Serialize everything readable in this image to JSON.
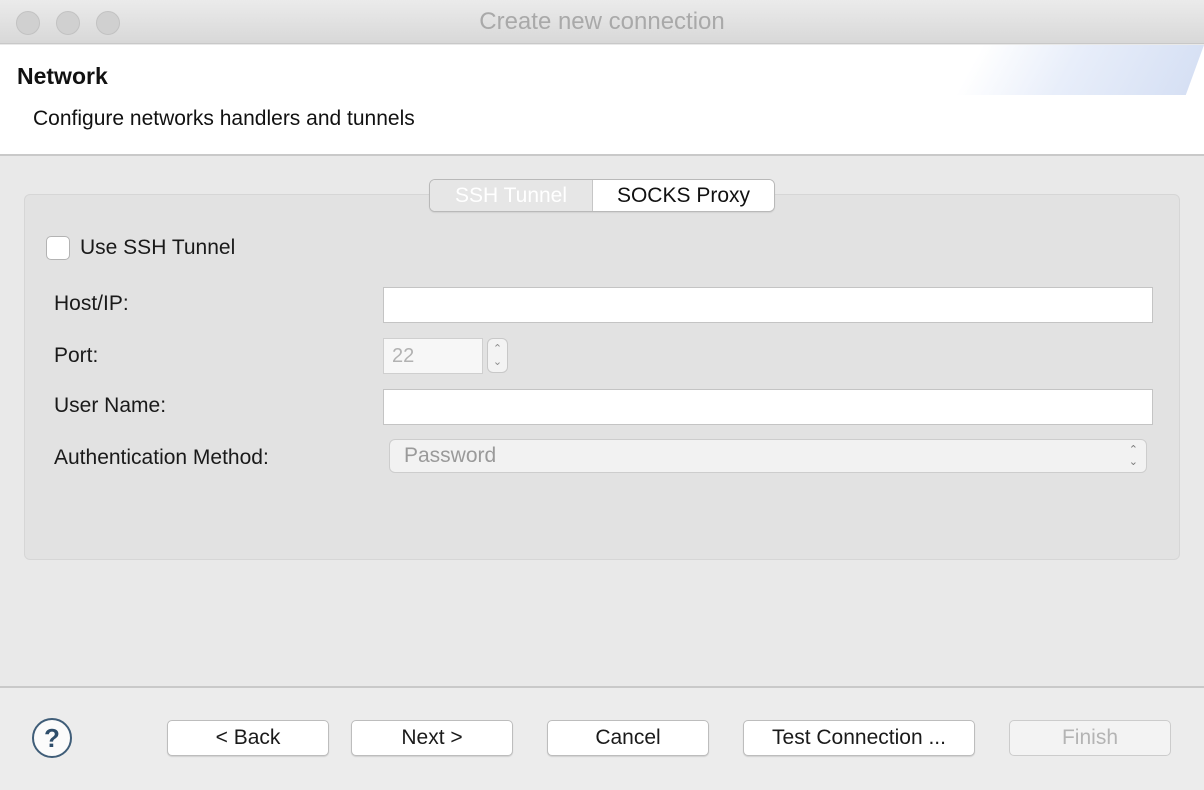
{
  "window": {
    "title": "Create new connection"
  },
  "header": {
    "title": "Network",
    "description": "Configure networks handlers and tunnels"
  },
  "tabs": [
    {
      "label": "SSH Tunnel",
      "selected": true
    },
    {
      "label": "SOCKS Proxy",
      "selected": false
    }
  ],
  "ssh": {
    "use_tunnel_label": "Use SSH Tunnel",
    "use_tunnel_checked": false,
    "host_label": "Host/IP:",
    "host_value": "",
    "port_label": "Port:",
    "port_value": "22",
    "user_label": "User Name:",
    "user_value": "",
    "auth_label": "Authentication Method:",
    "auth_value": "Password"
  },
  "footer": {
    "help_icon": "question-mark-icon",
    "back_label": "< Back",
    "next_label": "Next >",
    "cancel_label": "Cancel",
    "test_label": "Test Connection ...",
    "finish_label": "Finish"
  }
}
